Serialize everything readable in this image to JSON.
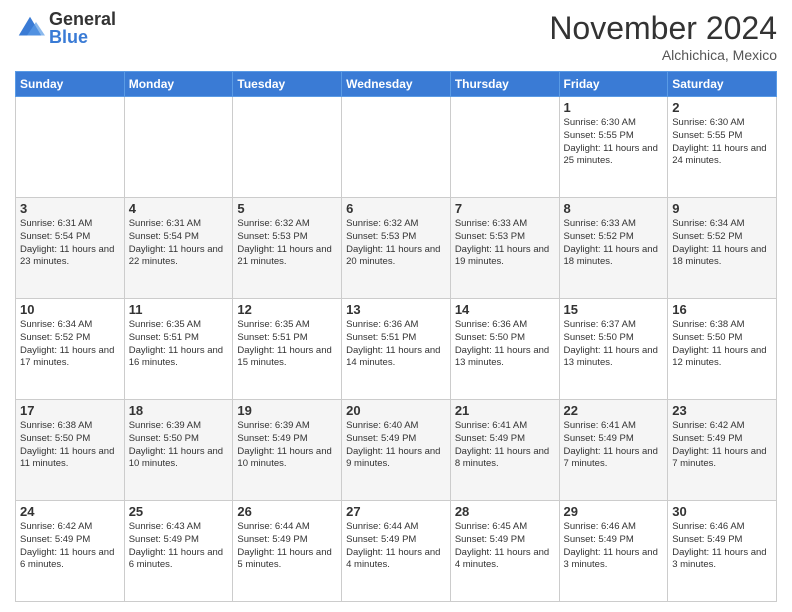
{
  "logo": {
    "general": "General",
    "blue": "Blue"
  },
  "header": {
    "month": "November 2024",
    "location": "Alchichica, Mexico"
  },
  "weekdays": [
    "Sunday",
    "Monday",
    "Tuesday",
    "Wednesday",
    "Thursday",
    "Friday",
    "Saturday"
  ],
  "weeks": [
    [
      {
        "day": "",
        "info": ""
      },
      {
        "day": "",
        "info": ""
      },
      {
        "day": "",
        "info": ""
      },
      {
        "day": "",
        "info": ""
      },
      {
        "day": "",
        "info": ""
      },
      {
        "day": "1",
        "info": "Sunrise: 6:30 AM\nSunset: 5:55 PM\nDaylight: 11 hours and 25 minutes."
      },
      {
        "day": "2",
        "info": "Sunrise: 6:30 AM\nSunset: 5:55 PM\nDaylight: 11 hours and 24 minutes."
      }
    ],
    [
      {
        "day": "3",
        "info": "Sunrise: 6:31 AM\nSunset: 5:54 PM\nDaylight: 11 hours and 23 minutes."
      },
      {
        "day": "4",
        "info": "Sunrise: 6:31 AM\nSunset: 5:54 PM\nDaylight: 11 hours and 22 minutes."
      },
      {
        "day": "5",
        "info": "Sunrise: 6:32 AM\nSunset: 5:53 PM\nDaylight: 11 hours and 21 minutes."
      },
      {
        "day": "6",
        "info": "Sunrise: 6:32 AM\nSunset: 5:53 PM\nDaylight: 11 hours and 20 minutes."
      },
      {
        "day": "7",
        "info": "Sunrise: 6:33 AM\nSunset: 5:53 PM\nDaylight: 11 hours and 19 minutes."
      },
      {
        "day": "8",
        "info": "Sunrise: 6:33 AM\nSunset: 5:52 PM\nDaylight: 11 hours and 18 minutes."
      },
      {
        "day": "9",
        "info": "Sunrise: 6:34 AM\nSunset: 5:52 PM\nDaylight: 11 hours and 18 minutes."
      }
    ],
    [
      {
        "day": "10",
        "info": "Sunrise: 6:34 AM\nSunset: 5:52 PM\nDaylight: 11 hours and 17 minutes."
      },
      {
        "day": "11",
        "info": "Sunrise: 6:35 AM\nSunset: 5:51 PM\nDaylight: 11 hours and 16 minutes."
      },
      {
        "day": "12",
        "info": "Sunrise: 6:35 AM\nSunset: 5:51 PM\nDaylight: 11 hours and 15 minutes."
      },
      {
        "day": "13",
        "info": "Sunrise: 6:36 AM\nSunset: 5:51 PM\nDaylight: 11 hours and 14 minutes."
      },
      {
        "day": "14",
        "info": "Sunrise: 6:36 AM\nSunset: 5:50 PM\nDaylight: 11 hours and 13 minutes."
      },
      {
        "day": "15",
        "info": "Sunrise: 6:37 AM\nSunset: 5:50 PM\nDaylight: 11 hours and 13 minutes."
      },
      {
        "day": "16",
        "info": "Sunrise: 6:38 AM\nSunset: 5:50 PM\nDaylight: 11 hours and 12 minutes."
      }
    ],
    [
      {
        "day": "17",
        "info": "Sunrise: 6:38 AM\nSunset: 5:50 PM\nDaylight: 11 hours and 11 minutes."
      },
      {
        "day": "18",
        "info": "Sunrise: 6:39 AM\nSunset: 5:50 PM\nDaylight: 11 hours and 10 minutes."
      },
      {
        "day": "19",
        "info": "Sunrise: 6:39 AM\nSunset: 5:49 PM\nDaylight: 11 hours and 10 minutes."
      },
      {
        "day": "20",
        "info": "Sunrise: 6:40 AM\nSunset: 5:49 PM\nDaylight: 11 hours and 9 minutes."
      },
      {
        "day": "21",
        "info": "Sunrise: 6:41 AM\nSunset: 5:49 PM\nDaylight: 11 hours and 8 minutes."
      },
      {
        "day": "22",
        "info": "Sunrise: 6:41 AM\nSunset: 5:49 PM\nDaylight: 11 hours and 7 minutes."
      },
      {
        "day": "23",
        "info": "Sunrise: 6:42 AM\nSunset: 5:49 PM\nDaylight: 11 hours and 7 minutes."
      }
    ],
    [
      {
        "day": "24",
        "info": "Sunrise: 6:42 AM\nSunset: 5:49 PM\nDaylight: 11 hours and 6 minutes."
      },
      {
        "day": "25",
        "info": "Sunrise: 6:43 AM\nSunset: 5:49 PM\nDaylight: 11 hours and 6 minutes."
      },
      {
        "day": "26",
        "info": "Sunrise: 6:44 AM\nSunset: 5:49 PM\nDaylight: 11 hours and 5 minutes."
      },
      {
        "day": "27",
        "info": "Sunrise: 6:44 AM\nSunset: 5:49 PM\nDaylight: 11 hours and 4 minutes."
      },
      {
        "day": "28",
        "info": "Sunrise: 6:45 AM\nSunset: 5:49 PM\nDaylight: 11 hours and 4 minutes."
      },
      {
        "day": "29",
        "info": "Sunrise: 6:46 AM\nSunset: 5:49 PM\nDaylight: 11 hours and 3 minutes."
      },
      {
        "day": "30",
        "info": "Sunrise: 6:46 AM\nSunset: 5:49 PM\nDaylight: 11 hours and 3 minutes."
      }
    ]
  ]
}
